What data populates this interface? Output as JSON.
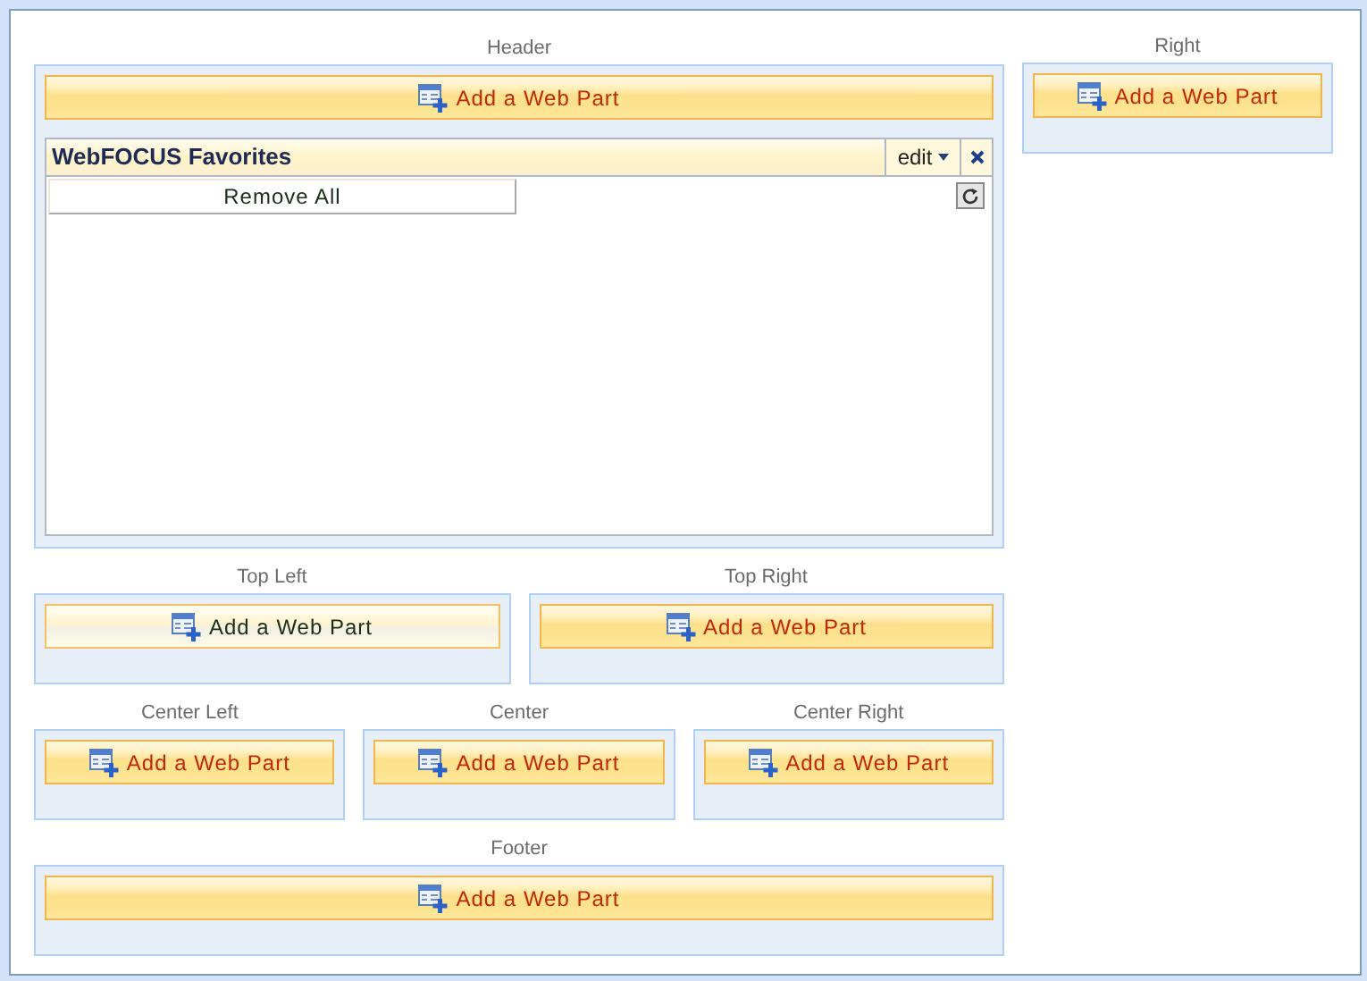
{
  "left_rows": [
    {
      "zones": [
        {
          "label": "Header",
          "button": "Add a Web Part",
          "hovered": false,
          "web_parts": [
            {
              "title": "WebFOCUS Favorites",
              "menu": "edit",
              "action": "Remove All"
            }
          ]
        }
      ]
    },
    {
      "zones": [
        {
          "label": "Top Left",
          "button": "Add a Web Part",
          "hovered": true
        },
        {
          "label": "Top Right",
          "button": "Add a Web Part",
          "hovered": false
        }
      ]
    },
    {
      "zones": [
        {
          "label": "Center Left",
          "button": "Add a Web Part",
          "hovered": false
        },
        {
          "label": "Center",
          "button": "Add a Web Part",
          "hovered": false
        },
        {
          "label": "Center Right",
          "button": "Add a Web Part",
          "hovered": false
        }
      ]
    },
    {
      "zones": [
        {
          "label": "Footer",
          "button": "Add a Web Part",
          "hovered": false
        }
      ]
    }
  ],
  "right_zones": [
    {
      "label": "Right",
      "button": "Add a Web Part",
      "hovered": false
    }
  ]
}
